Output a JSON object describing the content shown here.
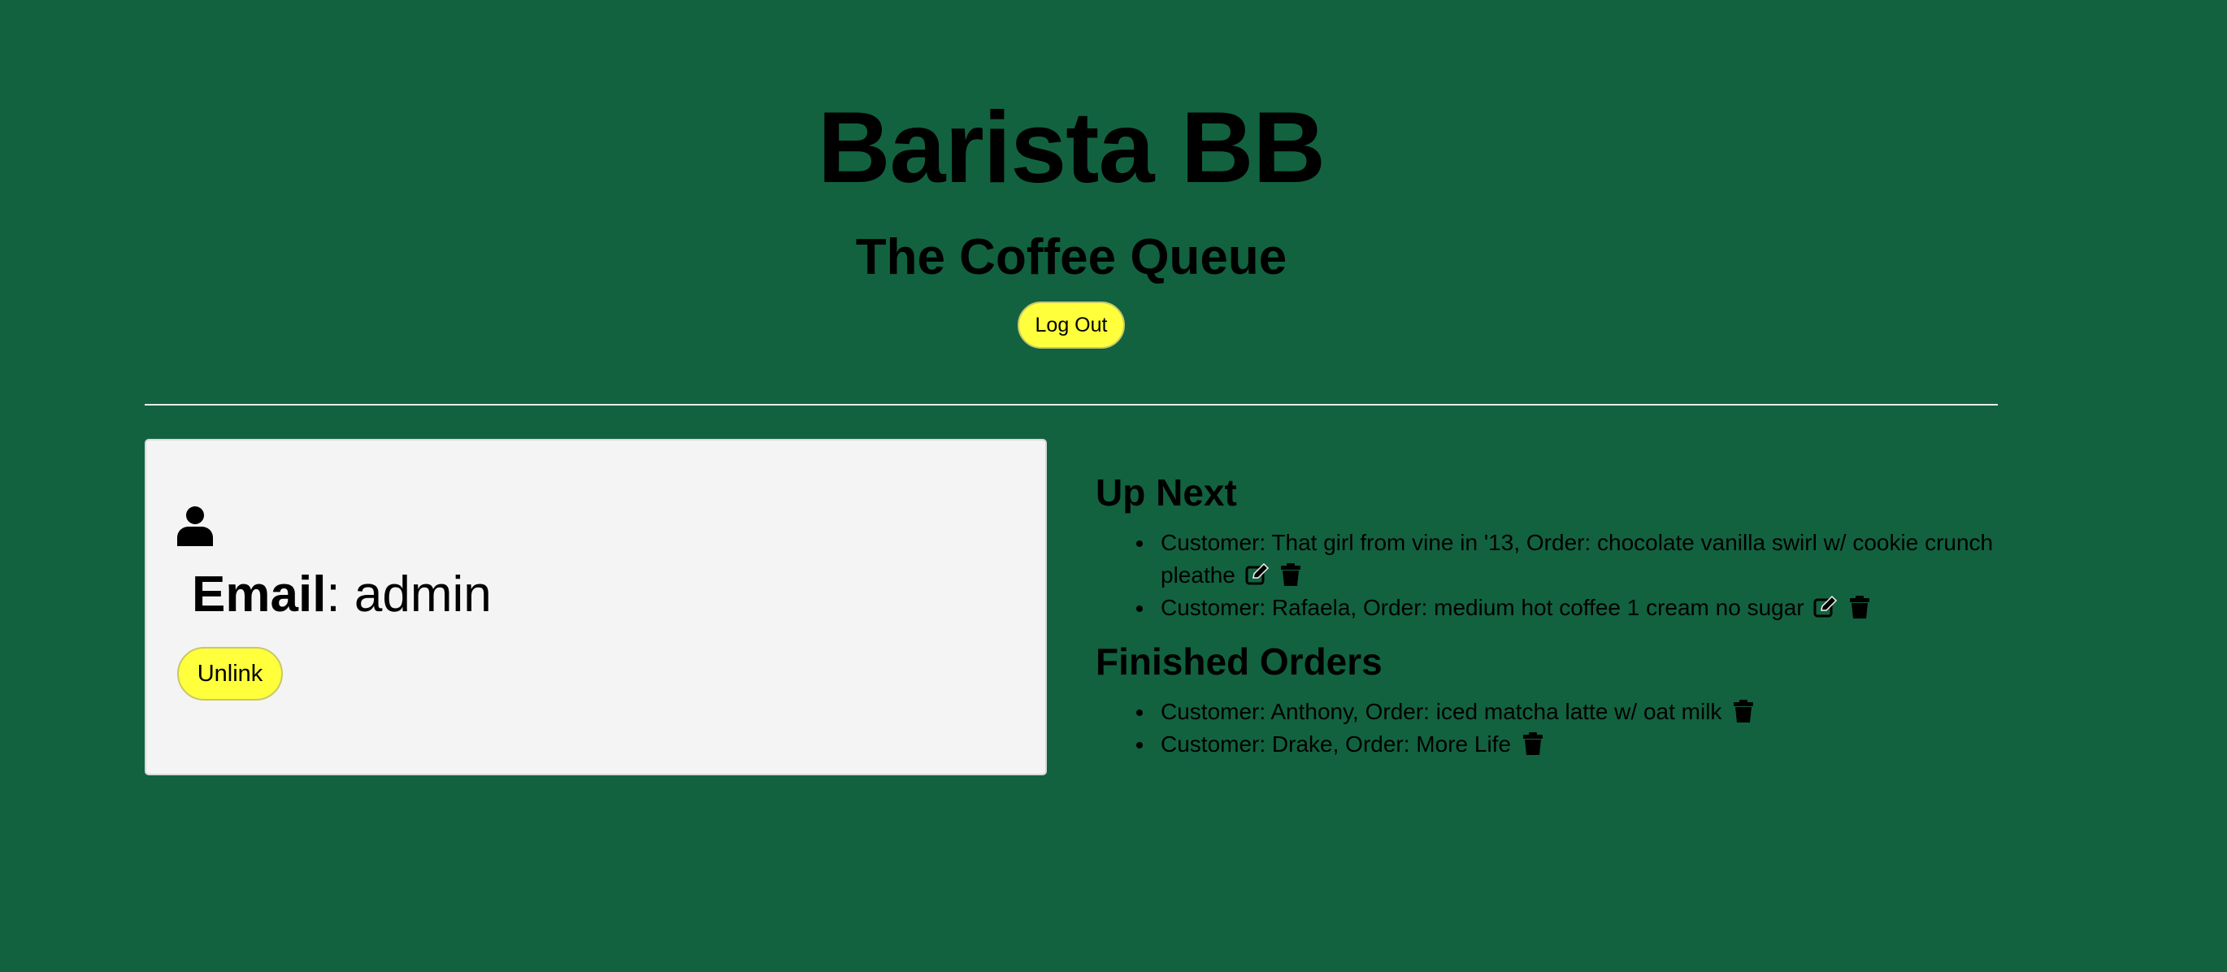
{
  "header": {
    "title": "Barista BB",
    "subtitle": "The Coffee Queue",
    "logout_label": "Log Out"
  },
  "profile": {
    "icon": "user-icon",
    "email_label": "Email",
    "email_separator": ": ",
    "email_value": "admin",
    "unlink_label": "Unlink"
  },
  "up_next": {
    "heading": "Up Next",
    "items": [
      {
        "text": "Customer: That girl from vine in '13, Order: chocolate vanilla swirl w/ cookie crunch pleathe"
      },
      {
        "text": "Customer: Rafaela, Order: medium hot coffee 1 cream no sugar"
      }
    ]
  },
  "finished": {
    "heading": "Finished Orders",
    "items": [
      {
        "text": "Customer: Anthony, Order: iced matcha latte w/ oat milk"
      },
      {
        "text": "Customer: Drake, Order: More Life"
      }
    ]
  },
  "colors": {
    "background": "#126240",
    "button": "#ffff3b",
    "card": "#f4f4f4",
    "divider": "#e8eee9"
  }
}
